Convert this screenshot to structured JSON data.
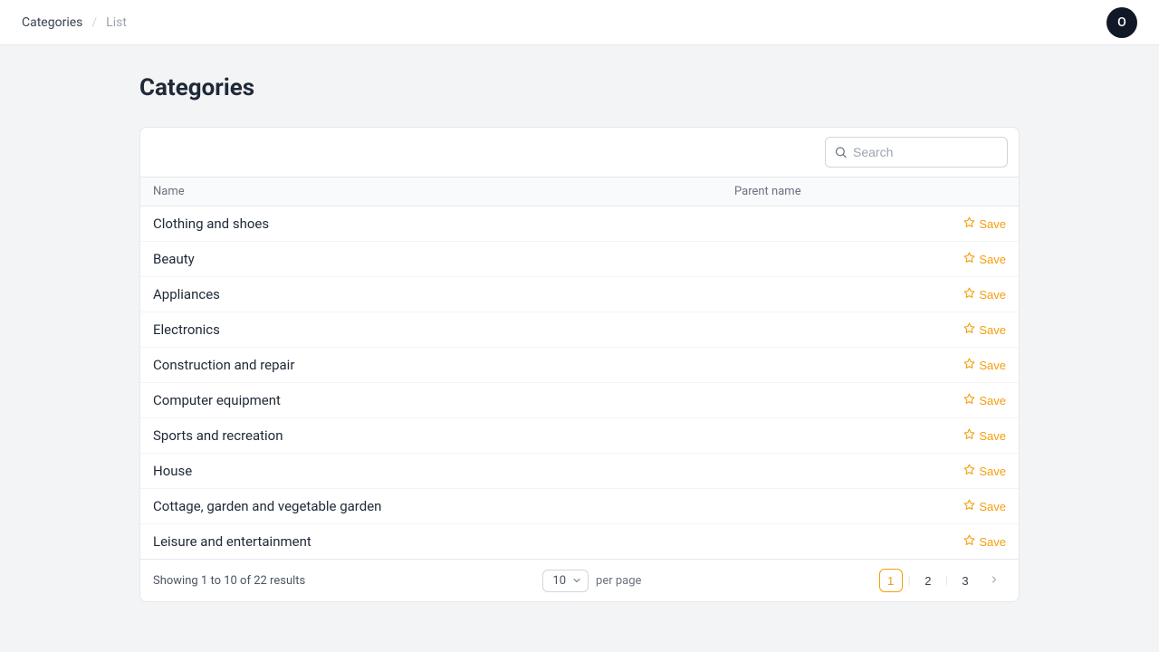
{
  "breadcrumb": {
    "parent": "Categories",
    "sep": "/",
    "current": "List"
  },
  "avatar": {
    "initial": "O"
  },
  "page": {
    "title": "Categories"
  },
  "search": {
    "placeholder": "Search",
    "value": ""
  },
  "table": {
    "headers": {
      "name": "Name",
      "parent": "Parent name"
    },
    "save_label": "Save",
    "rows": [
      {
        "name": "Clothing and shoes",
        "parent": ""
      },
      {
        "name": "Beauty",
        "parent": ""
      },
      {
        "name": "Appliances",
        "parent": ""
      },
      {
        "name": "Electronics",
        "parent": ""
      },
      {
        "name": "Construction and repair",
        "parent": ""
      },
      {
        "name": "Computer equipment",
        "parent": ""
      },
      {
        "name": "Sports and recreation",
        "parent": ""
      },
      {
        "name": "House",
        "parent": ""
      },
      {
        "name": "Cottage, garden and vegetable garden",
        "parent": ""
      },
      {
        "name": "Leisure and entertainment",
        "parent": ""
      }
    ]
  },
  "pagination": {
    "results_text": "Showing 1 to 10 of 22 results",
    "per_page_value": "10",
    "per_page_label": "per page",
    "pages": [
      "1",
      "2",
      "3"
    ],
    "current": "1"
  }
}
